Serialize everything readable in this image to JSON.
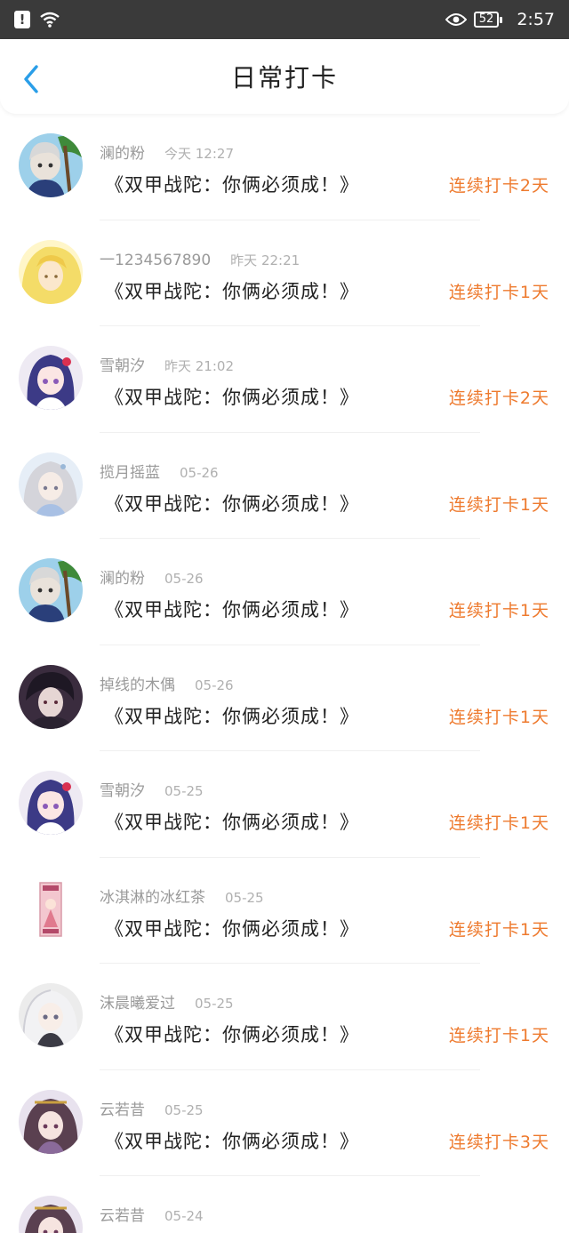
{
  "status_bar": {
    "time": "2:57",
    "battery": "52",
    "icons": [
      "alert-icon",
      "wifi-icon",
      "eye-icon",
      "battery-icon"
    ]
  },
  "header": {
    "title": "日常打卡",
    "back_icon": "chevron-left-icon",
    "accent_color": "#2a9ee8"
  },
  "streak_color": "#ee7a2e",
  "entries": [
    {
      "name": "澜的粉",
      "time": "今天 12:27",
      "content": "《双甲战陀：你俩必须成！》",
      "streak": "连续打卡2天",
      "avatar": "avatar-boy-palm"
    },
    {
      "name": "一1234567890",
      "time": "昨天 22:21",
      "content": "《双甲战陀：你俩必须成！》",
      "streak": "连续打卡1天",
      "avatar": "avatar-blonde"
    },
    {
      "name": "雪朝汐",
      "time": "昨天 21:02",
      "content": "《双甲战陀：你俩必须成！》",
      "streak": "连续打卡2天",
      "avatar": "avatar-purple-hair"
    },
    {
      "name": "揽月摇蓝",
      "time": "05-26",
      "content": "《双甲战陀：你俩必须成！》",
      "streak": "连续打卡1天",
      "avatar": "avatar-silver-hair"
    },
    {
      "name": "澜的粉",
      "time": "05-26",
      "content": "《双甲战陀：你俩必须成！》",
      "streak": "连续打卡1天",
      "avatar": "avatar-boy-palm"
    },
    {
      "name": "掉线的木偶",
      "time": "05-26",
      "content": "《双甲战陀：你俩必须成！》",
      "streak": "连续打卡1天",
      "avatar": "avatar-dark-boy"
    },
    {
      "name": "雪朝汐",
      "time": "05-25",
      "content": "《双甲战陀：你俩必须成！》",
      "streak": "连续打卡1天",
      "avatar": "avatar-purple-hair"
    },
    {
      "name": "冰淇淋的冰红茶",
      "time": "05-25",
      "content": "《双甲战陀：你俩必须成！》",
      "streak": "连续打卡1天",
      "avatar": "avatar-card"
    },
    {
      "name": "沫晨曦爱过",
      "time": "05-25",
      "content": "《双甲战陀：你俩必须成！》",
      "streak": "连续打卡1天",
      "avatar": "avatar-white-hair"
    },
    {
      "name": "云若昔",
      "time": "05-25",
      "content": "《双甲战陀：你俩必须成！》",
      "streak": "连续打卡3天",
      "avatar": "avatar-brown-hair"
    },
    {
      "name": "云若昔",
      "time": "05-24",
      "content": "",
      "streak": "",
      "avatar": "avatar-brown-hair"
    }
  ]
}
